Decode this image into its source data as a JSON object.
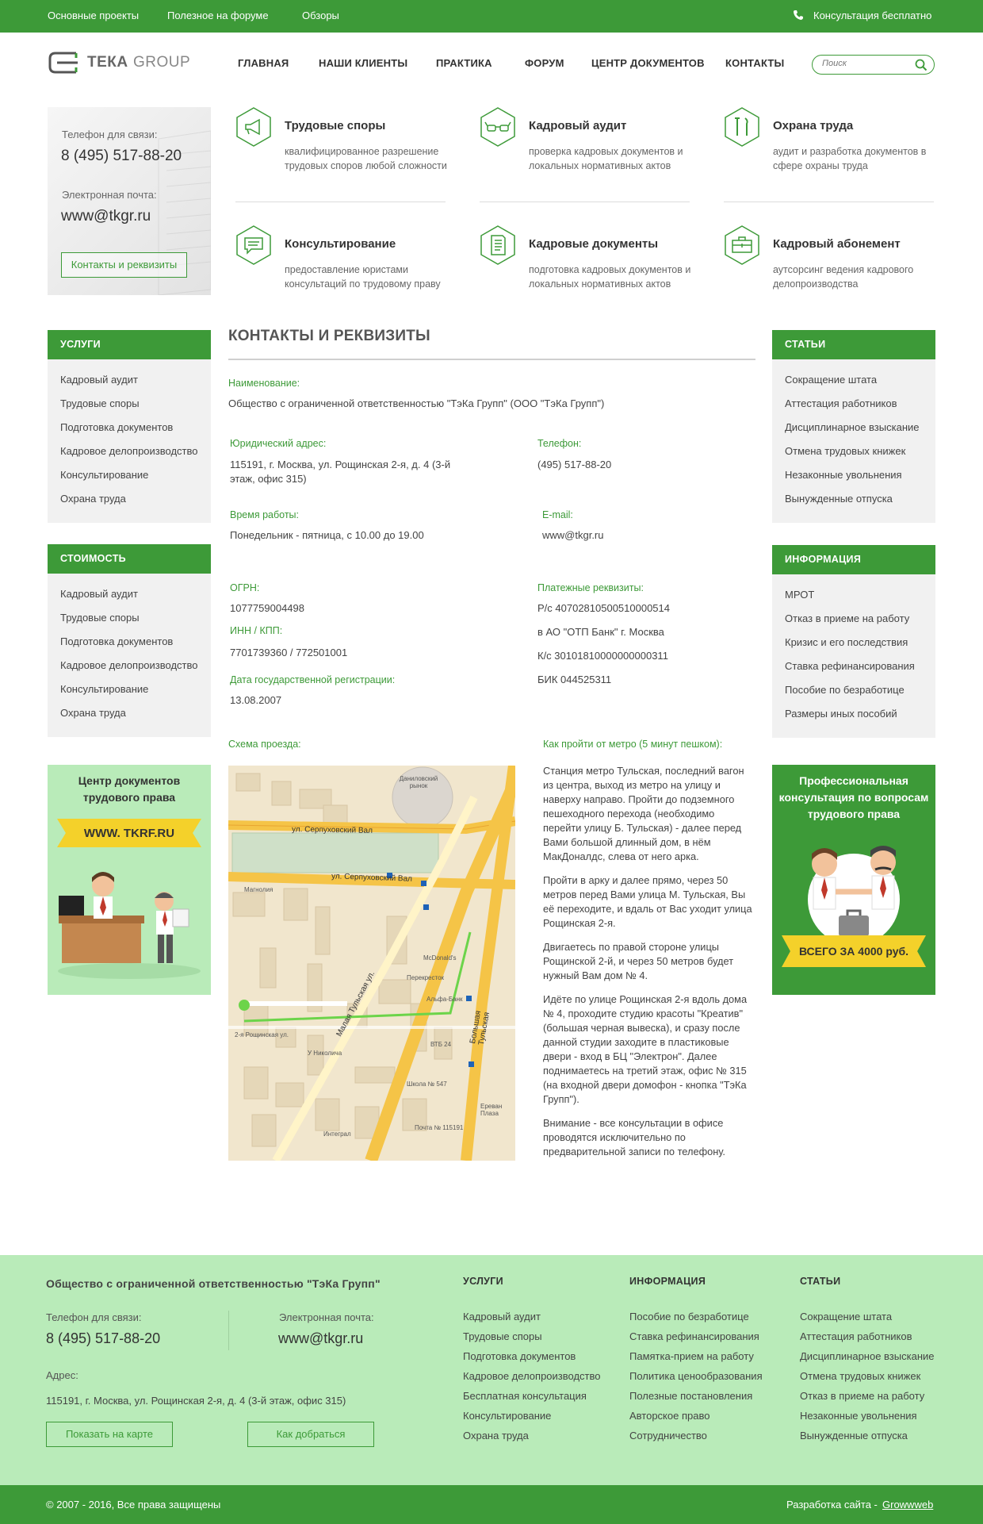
{
  "topbar": {
    "links": [
      "Основные проекты",
      "Полезное на форуме",
      "Обзоры"
    ],
    "consult": "Консультация бесплатно"
  },
  "logo": {
    "text_a": "ТЕКА",
    "text_b": "GROUP"
  },
  "nav": [
    "ГЛАВНАЯ",
    "НАШИ КЛИЕНТЫ",
    "ПРАКТИКА",
    "ФОРУМ",
    "ЦЕНТР ДОКУМЕНТОВ",
    "КОНТАКТЫ"
  ],
  "search": {
    "placeholder": "Поиск"
  },
  "contact_card": {
    "phone_label": "Телефон для связи:",
    "phone": "8 (495) 517-88-20",
    "email_label": "Электронная почта:",
    "email": "www@tkgr.ru",
    "button": "Контакты и реквизиты"
  },
  "services": [
    {
      "title": "Трудовые споры",
      "desc": "квалифицированное разрешение трудовых споров любой сложности",
      "icon": "megaphone-icon"
    },
    {
      "title": "Кадровый аудит",
      "desc": "проверка кадровых документов и локальных нормативных актов",
      "icon": "glasses-icon"
    },
    {
      "title": "Охрана труда",
      "desc": "аудит и разработка документов в сфере охраны труда",
      "icon": "tools-icon"
    },
    {
      "title": "Консультирование",
      "desc": "предоставление юристами консультаций по трудовому праву",
      "icon": "chat-icon"
    },
    {
      "title": "Кадровые документы",
      "desc": "подготовка кадровых документов и локальных нормативных актов",
      "icon": "document-icon"
    },
    {
      "title": "Кадровый абонемент",
      "desc": "аутсорсинг ведения кадрового делопроизводства",
      "icon": "briefcase-icon"
    }
  ],
  "left_services": {
    "title": "УСЛУГИ",
    "items": [
      "Кадровый аудит",
      "Трудовые споры",
      "Подготовка документов",
      "Кадровое делопроизводство",
      "Консультирование",
      "Охрана труда"
    ]
  },
  "left_cost": {
    "title": "СТОИМОСТЬ",
    "items": [
      "Кадровый аудит",
      "Трудовые споры",
      "Подготовка документов",
      "Кадровое делопроизводство",
      "Консультирование",
      "Охрана труда"
    ]
  },
  "right_articles": {
    "title": "СТАТЬИ",
    "items": [
      "Сокращение штата",
      "Аттестация работников",
      "Дисциплинарное взыскание",
      "Отмена трудовых книжек",
      "Незаконные увольнения",
      "Вынужденные отпуска"
    ]
  },
  "right_info": {
    "title": "ИНФОРМАЦИЯ",
    "items": [
      "МРОТ",
      "Отказ в приеме на работу",
      "Кризис и его последствия",
      "Ставка рефинансирования",
      "Пособие по безработице",
      "Размеры иных пособий"
    ]
  },
  "banner_left": {
    "title": "Центр документов трудового права",
    "ribbon": "WWW. TKRF.RU"
  },
  "banner_right": {
    "title": "Профессиональная консультация по вопросам трудового права",
    "ribbon": "ВСЕГО ЗА 4000 руб."
  },
  "main": {
    "title": "КОНТАКТЫ И РЕКВИЗИТЫ",
    "name_label": "Наименование:",
    "name": "Общество с ограниченной ответственностью \"ТэКа Групп\" (ООО \"ТэКа Групп\")",
    "address_label": "Юридический адрес:",
    "address": "115191, г. Москва, ул. Рощинская 2-я, д. 4 (3-й этаж, офис 315)",
    "phone_label": "Телефон:",
    "phone": "(495) 517-88-20",
    "hours_label": "Время работы:",
    "hours": "Понедельник - пятница, с 10.00 до 19.00",
    "email_label": "E-mail:",
    "email": "www@tkgr.ru",
    "ogrn_label": "ОГРН:",
    "ogrn": "1077759004498",
    "inn_label": "ИНН / КПП:",
    "inn": "7701739360 / 772501001",
    "reg_label": "Дата государственной регистрации:",
    "reg": "13.08.2007",
    "pay_label": "Платежные реквизиты:",
    "pay": [
      "Р/с 40702810500510000514",
      "в АО \"ОТП Банк\" г. Москва",
      "К/с 30101810000000000311",
      "БИК 044525311"
    ],
    "map_label": "Схема проезда:",
    "metro_label": "Как пройти от метро (5 минут пешком):",
    "directions": [
      "Станция метро Тульская, последний вагон из центра, выход из метро на улицу и наверху направо. Пройти до подземного пешеходного перехода (необходимо перейти улицу Б. Тульская) - далее перед Вами большой длинный дом, в нём МакДоналдс, слева от него арка.",
      "Пройти в арку и далее прямо, через 50 метров перед Вами улица М. Тульская, Вы её переходите, и вдаль от Вас уходит улица Рощинская 2-я.",
      "Двигаетесь по правой стороне улицы Рощинской 2-й, и через 50 метров будет нужный Вам дом № 4.",
      "Идёте по улице Рощинская 2-я вдоль дома № 4, проходите студию красоты \"Креатив\" (большая черная вывеска), и сразу после данной студии заходите в пластиковые двери - вход в БЦ \"Электрон\". Далее поднимаетесь на третий этаж, офис № 315 (на входной двери домофон - кнопка \"ТэКа Групп\").",
      "Внимание - все консультации в офисе проводятся исключительно по предварительной записи по телефону."
    ]
  },
  "map": {
    "labels": [
      "ул. Серпуховский Вал",
      "ул. Серпуховский Вал",
      "Малая Тульская ул.",
      "Большая Тульская",
      "Даниловский рынок",
      "McDonald's",
      "Перекресток",
      "Альфа-Банк",
      "ВТБ 24",
      "Школа № 547",
      "Почта № 115191",
      "Интеграл",
      "Ереван Плаза",
      "У Николича",
      "2-я Рощинская ул.",
      "Магнолия"
    ]
  },
  "footer": {
    "company": "Общество с ограниченной ответственностью \"ТэКа Групп\"",
    "phone_label": "Телефон для связи:",
    "phone": "8 (495) 517-88-20",
    "email_label": "Электронная почта:",
    "email": "www@tkgr.ru",
    "address_label": "Адрес:",
    "address": "115191, г. Москва, ул. Рощинская 2-я, д. 4 (3-й этаж, офис 315)",
    "map_button": "Показать на карте",
    "route_button": "Как добраться",
    "col1": {
      "title": "УСЛУГИ",
      "items": [
        "Кадровый аудит",
        "Трудовые споры",
        "Подготовка документов",
        "Кадровое делопроизводство",
        "Бесплатная консультация",
        "Консультирование",
        "Охрана труда"
      ]
    },
    "col2": {
      "title": "ИНФОРМАЦИЯ",
      "items": [
        "Пособие по безработице",
        "Ставка рефинансирования",
        "Памятка-прием на работу",
        "Политика ценообразования",
        "Полезные постановления",
        "Авторское право",
        "Сотрудничество"
      ]
    },
    "col3": {
      "title": "СТАТЬИ",
      "items": [
        "Сокращение штата",
        "Аттестация работников",
        "Дисциплинарное взыскание",
        "Отмена трудовых книжек",
        "Отказ в приеме на работу",
        "Незаконные увольнения",
        "Вынужденные отпуска"
      ]
    },
    "copyright": "© 2007 - 2016, Все права защищены",
    "dev_label": "Разработка сайта -",
    "dev_link": "Growwweb"
  },
  "colors": {
    "brand_green": "#3d9a38",
    "footer_green": "#b9ebb9",
    "banner_yellow": "#f4d12a"
  }
}
